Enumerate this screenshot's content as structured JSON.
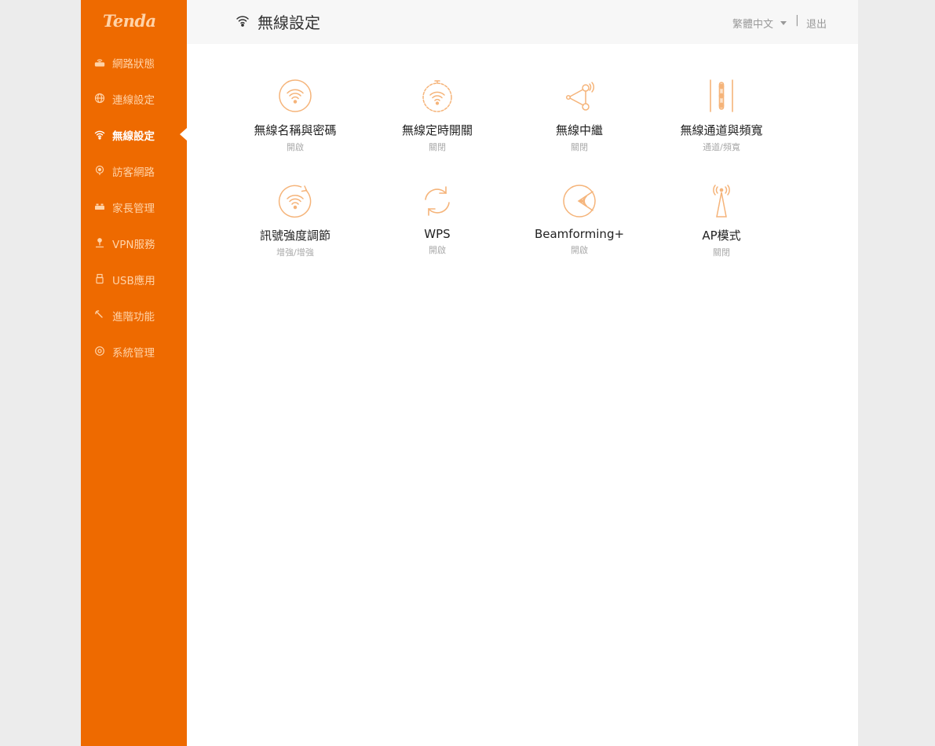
{
  "brand": {
    "logo": "Tenda",
    "accent": "#ee6a00",
    "icon_color": "#f5b47a"
  },
  "sidebar": {
    "items": [
      {
        "label": "網路狀態",
        "icon": "router-icon",
        "active": false
      },
      {
        "label": "連線設定",
        "icon": "globe-icon",
        "active": false
      },
      {
        "label": "無線設定",
        "icon": "wifi-icon",
        "active": true
      },
      {
        "label": "訪客網路",
        "icon": "guest-icon",
        "active": false
      },
      {
        "label": "家長管理",
        "icon": "parental-icon",
        "active": false
      },
      {
        "label": "VPN服務",
        "icon": "vpn-icon",
        "active": false
      },
      {
        "label": "USB應用",
        "icon": "usb-icon",
        "active": false
      },
      {
        "label": "進階功能",
        "icon": "wrench-icon",
        "active": false
      },
      {
        "label": "系統管理",
        "icon": "gear-icon",
        "active": false
      }
    ]
  },
  "header": {
    "title": "無線設定",
    "language": "繁體中文",
    "separator": "|",
    "logout": "退出"
  },
  "tiles": [
    {
      "name": "無線名稱與密碼",
      "status": "開啟",
      "icon": "wifi-circle-icon"
    },
    {
      "name": "無線定時開關",
      "status": "關閉",
      "icon": "wifi-timer-icon"
    },
    {
      "name": "無線中繼",
      "status": "關閉",
      "icon": "repeater-icon"
    },
    {
      "name": "無線通道與頻寬",
      "status": "通道/頻寬",
      "icon": "channel-icon"
    },
    {
      "name": "訊號強度調節",
      "status": "增強/增強",
      "icon": "signal-strength-icon"
    },
    {
      "name": "WPS",
      "status": "開啟",
      "icon": "wps-icon"
    },
    {
      "name": "Beamforming+",
      "status": "開啟",
      "icon": "beamforming-icon"
    },
    {
      "name": "AP模式",
      "status": "關閉",
      "icon": "ap-tower-icon"
    }
  ]
}
